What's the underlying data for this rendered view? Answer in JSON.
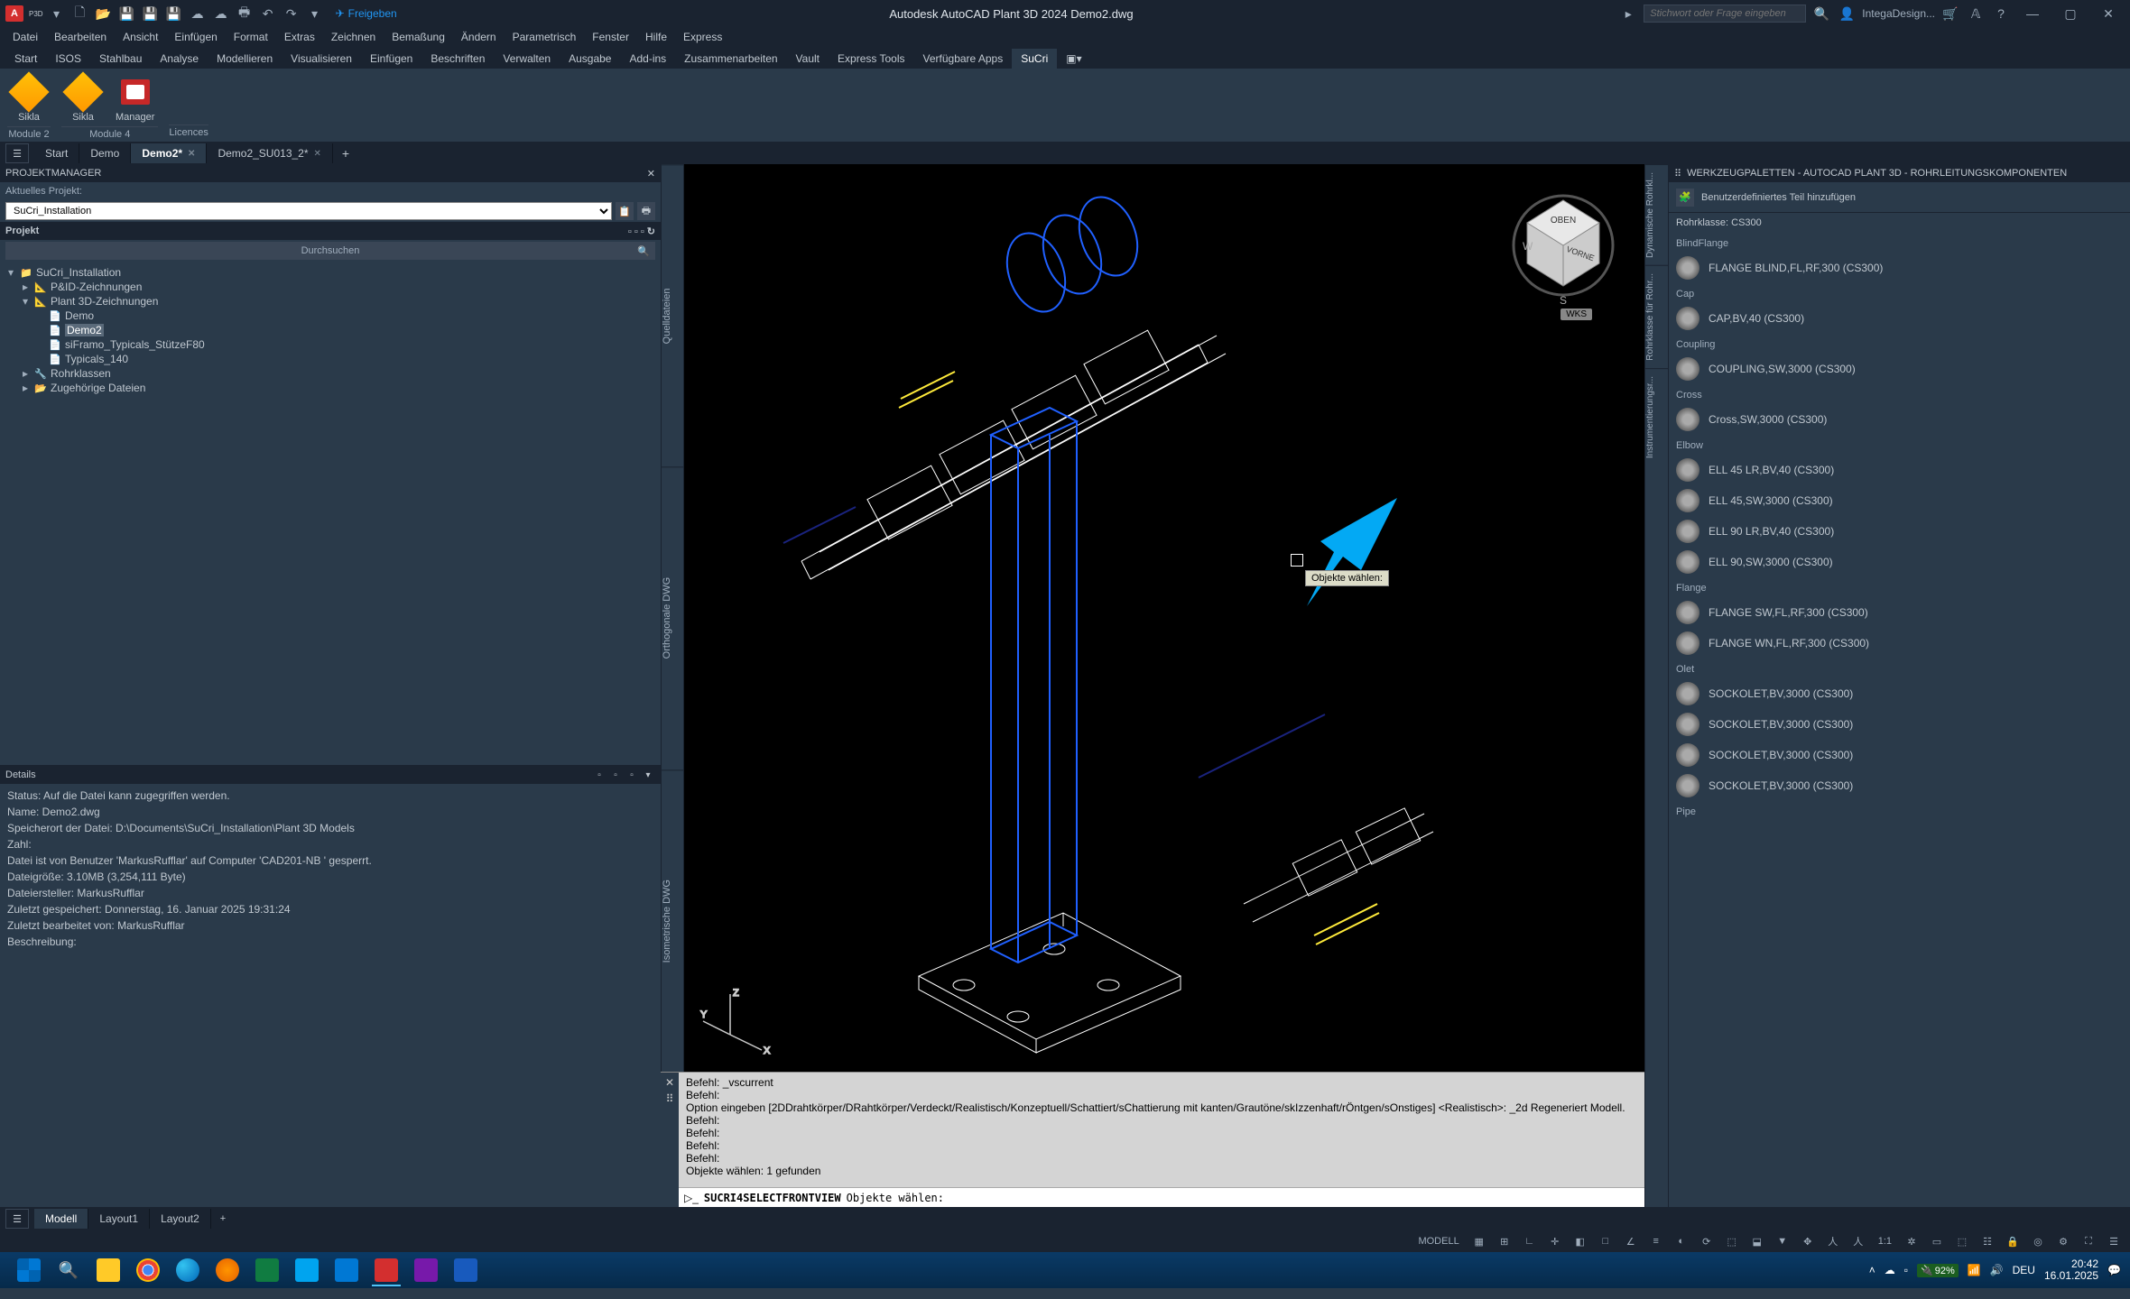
{
  "title": "Autodesk AutoCAD Plant 3D 2024   Demo2.dwg",
  "logo": "A",
  "logo_sub": "P3D",
  "share_label": "Freigeben",
  "search_placeholder": "Stichwort oder Frage eingeben",
  "user_name": "IntegaDesign...",
  "menus": [
    "Datei",
    "Bearbeiten",
    "Ansicht",
    "Einfügen",
    "Format",
    "Extras",
    "Zeichnen",
    "Bemaßung",
    "Ändern",
    "Parametrisch",
    "Fenster",
    "Hilfe",
    "Express"
  ],
  "ribbon_tabs": [
    "Start",
    "ISOS",
    "Stahlbau",
    "Analyse",
    "Modellieren",
    "Visualisieren",
    "Einfügen",
    "Beschriften",
    "Verwalten",
    "Ausgabe",
    "Add-ins",
    "Zusammenarbeiten",
    "Vault",
    "Express Tools",
    "Verfügbare Apps",
    "SuCri"
  ],
  "ribbon_active": "SuCri",
  "ribbon": {
    "sikla1": "Sikla",
    "sikla2": "Sikla",
    "manager": "Manager",
    "panel1": "Module 2",
    "panel2": "Module 4",
    "panel3": "Licences"
  },
  "doc_tabs": [
    {
      "label": "Start",
      "active": false,
      "closable": false
    },
    {
      "label": "Demo",
      "active": false,
      "closable": false
    },
    {
      "label": "Demo2*",
      "active": true,
      "closable": true
    },
    {
      "label": "Demo2_SU013_2*",
      "active": false,
      "closable": true
    }
  ],
  "pm": {
    "title": "PROJEKTMANAGER",
    "current_label": "Aktuelles Projekt:",
    "project": "SuCri_Installation",
    "section": "Projekt",
    "search": "Durchsuchen",
    "tree": [
      {
        "ind": 0,
        "exp": "▾",
        "ico": "📁",
        "label": "SuCri_Installation"
      },
      {
        "ind": 1,
        "exp": "▸",
        "ico": "📐",
        "label": "P&ID-Zeichnungen"
      },
      {
        "ind": 1,
        "exp": "▾",
        "ico": "📐",
        "label": "Plant 3D-Zeichnungen"
      },
      {
        "ind": 2,
        "exp": "",
        "ico": "📄",
        "label": "Demo"
      },
      {
        "ind": 2,
        "exp": "",
        "ico": "📄",
        "label": "Demo2",
        "sel": true
      },
      {
        "ind": 2,
        "exp": "",
        "ico": "📄",
        "label": "siFramo_Typicals_StützeF80"
      },
      {
        "ind": 2,
        "exp": "",
        "ico": "📄",
        "label": "Typicals_140"
      },
      {
        "ind": 1,
        "exp": "▸",
        "ico": "🔧",
        "label": "Rohrklassen"
      },
      {
        "ind": 1,
        "exp": "▸",
        "ico": "📂",
        "label": "Zugehörige Dateien"
      }
    ]
  },
  "details": {
    "title": "Details",
    "lines": [
      "Status: Auf die Datei kann zugegriffen werden.",
      "Name: Demo2.dwg",
      "Speicherort der Datei: D:\\Documents\\SuCri_Installation\\Plant 3D Models",
      "Zahl:",
      "Datei ist von Benutzer 'MarkusRufflar' auf Computer 'CAD201-NB ' gesperrt.",
      "Dateigröße: 3.10MB (3,254,111 Byte)",
      "Dateiersteller: MarkusRufflar",
      "Zuletzt gespeichert: Donnerstag, 16. Januar 2025 19:31:24",
      "Zuletzt bearbeitet von: MarkusRufflar",
      "Beschreibung:"
    ]
  },
  "side_tabs_left": [
    "Quelldateien",
    "Orthogonale DWG",
    "Isometrische DWG"
  ],
  "viewport": {
    "tooltip": "Objekte wählen:",
    "wks": "WKS",
    "cube_top": "OBEN",
    "cube_front": "VORNE"
  },
  "cmd": {
    "history": "Befehl: _vscurrent\nBefehl:\nOption eingeben [2DDrahtkörper/DRahtkörper/Verdeckt/Realistisch/Konzeptuell/Schattiert/sChattierung mit kanten/Grautöne/skIzzenhaft/rÖntgen/sOnstiges] <Realistisch>: _2d Regeneriert Modell.\nBefehl:\nBefehl:\nBefehl:\nBefehl:\nObjekte wählen: 1 gefunden",
    "prompt_cmd": "SUCRI4SELECTFRONTVIEW",
    "prompt_txt": "Objekte wählen:"
  },
  "palette": {
    "title": "WERKZEUGPALETTEN - AUTOCAD PLANT 3D - ROHRLEITUNGSKOMPONENTEN",
    "add_label": "Benutzerdefiniertes Teil hinzufügen",
    "spec": "Rohrklasse: CS300",
    "side_tabs": [
      "Dynamische Rohrkl...",
      "Rohrklasse für Rohr...",
      "Instrumentierungsr..."
    ],
    "cats": [
      {
        "name": "BlindFlange",
        "items": [
          "FLANGE BLIND,FL,RF,300 (CS300)"
        ]
      },
      {
        "name": "Cap",
        "items": [
          "CAP,BV,40 (CS300)"
        ]
      },
      {
        "name": "Coupling",
        "items": [
          "COUPLING,SW,3000 (CS300)"
        ]
      },
      {
        "name": "Cross",
        "items": [
          "Cross,SW,3000 (CS300)"
        ]
      },
      {
        "name": "Elbow",
        "items": [
          "ELL 45 LR,BV,40 (CS300)",
          "ELL 45,SW,3000 (CS300)",
          "ELL 90 LR,BV,40 (CS300)",
          "ELL 90,SW,3000 (CS300)"
        ]
      },
      {
        "name": "Flange",
        "items": [
          "FLANGE SW,FL,RF,300 (CS300)",
          "FLANGE WN,FL,RF,300 (CS300)"
        ]
      },
      {
        "name": "Olet",
        "items": [
          "SOCKOLET,BV,3000 (CS300)",
          "SOCKOLET,BV,3000 (CS300)",
          "SOCKOLET,BV,3000 (CS300)",
          "SOCKOLET,BV,3000 (CS300)"
        ]
      },
      {
        "name": "Pipe",
        "items": []
      }
    ]
  },
  "layout_tabs": [
    "Modell",
    "Layout1",
    "Layout2"
  ],
  "status": {
    "model": "MODELL",
    "scale": "1:1",
    "battery": "92%",
    "time": "20:42",
    "date": "16.01.2025"
  }
}
